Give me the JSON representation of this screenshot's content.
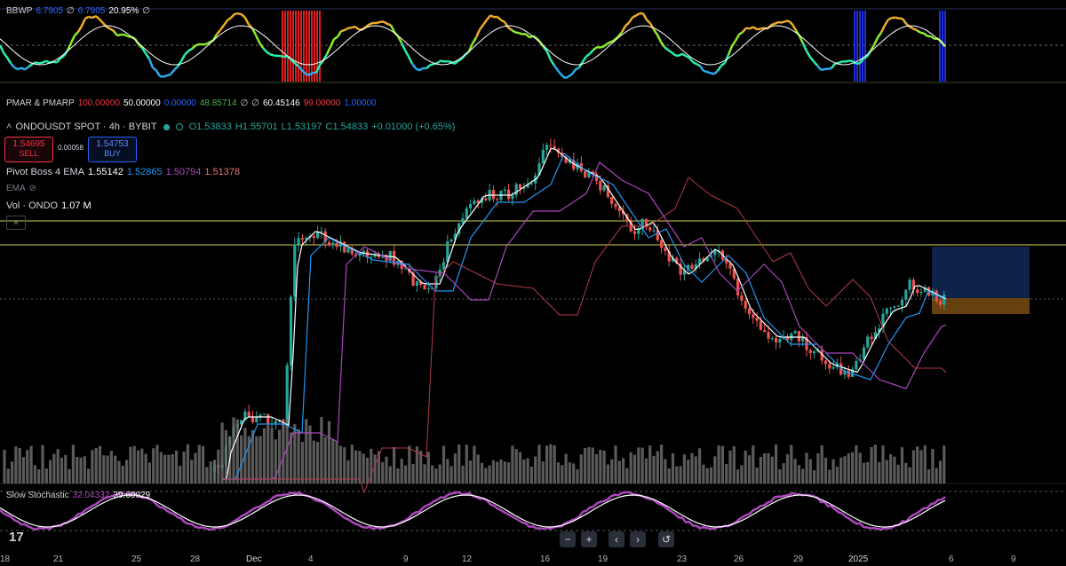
{
  "bbwp": {
    "name": "BBWP",
    "v1": "6.7905",
    "v2": "6.7905",
    "v3": "20.95%",
    "sym": "∅"
  },
  "pmar": {
    "name": "PMAR & PMARP",
    "v1": "100.00000",
    "v2": "50.00000",
    "v3": "0.00000",
    "v4": "48.85714",
    "v5": "60.45146",
    "v6": "99.00000",
    "v7": "1.00000",
    "sym": "∅"
  },
  "symbol": {
    "title": "ONDOUSDT SPOT · 4h · BYBIT",
    "o": "O1.53833",
    "h": "H1.55701",
    "l": "L1.53197",
    "c": "C1.54833",
    "chg": "+0.01000 (+0.65%)"
  },
  "trade": {
    "sell_price": "1.54695",
    "sell_label": "SELL",
    "spread": "0.00058",
    "buy_price": "1.54753",
    "buy_label": "BUY"
  },
  "pivot": {
    "name": "Pivot Boss 4 EMA",
    "v1": "1.55142",
    "v2": "1.52865",
    "v3": "1.50794",
    "v4": "1.51378"
  },
  "ema": {
    "name": "EMA"
  },
  "vol": {
    "name": "Vol · ONDO",
    "value": "1.07 M"
  },
  "stoch": {
    "name": "Slow Stochastic",
    "v1": "32.04332",
    "v2": "39.60029"
  },
  "controls": {
    "minus": "−",
    "plus": "+",
    "left": "‹",
    "right": "›",
    "reset": "↺"
  },
  "logo": "17",
  "xaxis": [
    "18",
    "21",
    "25",
    "28",
    "Dec",
    "4",
    "9",
    "12",
    "16",
    "19",
    "23",
    "26",
    "29",
    "2025",
    "6",
    "9"
  ],
  "colors": {
    "up": "#26a69a",
    "down": "#ef5350",
    "accent": "#2962ff"
  }
}
